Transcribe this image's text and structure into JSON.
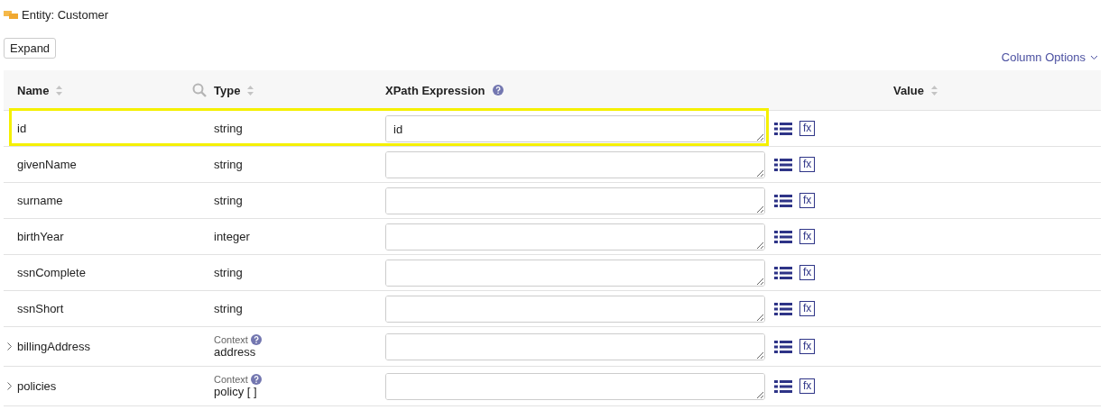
{
  "entity_title": "Entity: Customer",
  "expand_button": "Expand",
  "column_options": "Column Options",
  "columns": [
    "Name",
    "Type",
    "XPath Expression",
    "Value"
  ],
  "rows": [
    {
      "name": "id",
      "type": "string",
      "xpath": "id",
      "highlighted": true,
      "expandable": false,
      "fx": "fx"
    },
    {
      "name": "givenName",
      "type": "string",
      "highlighted": false,
      "expandable": false,
      "fx": "fx"
    },
    {
      "name": "surname",
      "type": "string",
      "highlighted": false,
      "expandable": false,
      "fx": "fx"
    },
    {
      "name": "birthYear",
      "type": "integer",
      "highlighted": false,
      "expandable": false,
      "fx": "fx"
    },
    {
      "name": "ssnComplete",
      "type": "string",
      "highlighted": false,
      "expandable": false,
      "fx": "fx"
    },
    {
      "name": "ssnShort",
      "type": "string",
      "highlighted": false,
      "expandable": false,
      "fx": "fx"
    },
    {
      "name": "billingAddress",
      "context": "Context",
      "type": "address",
      "highlighted": false,
      "expandable": true,
      "fx": "fx"
    },
    {
      "name": "policies",
      "context": "Context",
      "type": "policy [ ]",
      "highlighted": false,
      "expandable": true,
      "fx": "fx"
    }
  ]
}
